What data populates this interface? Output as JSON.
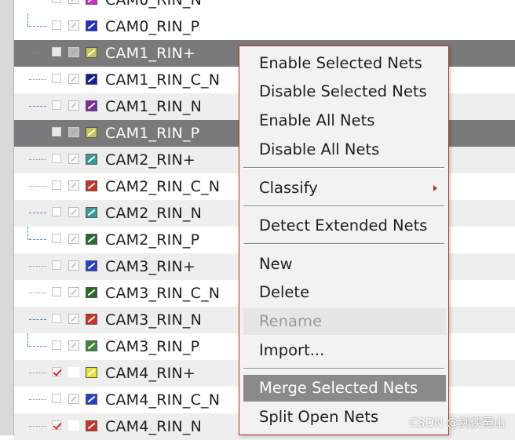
{
  "nets": [
    {
      "name": "CAM0_RIN_N",
      "color": "#d02cd0",
      "checked": false,
      "visible": true,
      "selected": false
    },
    {
      "name": "CAM0_RIN_P",
      "color": "#2030d0",
      "checked": false,
      "visible": true,
      "selected": false
    },
    {
      "name": "CAM1_RIN+",
      "color": "#c9c25a",
      "checked": false,
      "visible": true,
      "selected": true
    },
    {
      "name": "CAM1_RIN_C_N",
      "color": "#1020a0",
      "checked": false,
      "visible": true,
      "selected": false
    },
    {
      "name": "CAM1_RIN_N",
      "color": "#7a2aa0",
      "checked": false,
      "visible": true,
      "selected": false
    },
    {
      "name": "CAM1_RIN_P",
      "color": "#c9c25a",
      "checked": false,
      "visible": true,
      "selected": true
    },
    {
      "name": "CAM2_RIN+",
      "color": "#3a9a9a",
      "checked": false,
      "visible": true,
      "selected": false
    },
    {
      "name": "CAM2_RIN_C_N",
      "color": "#d03020",
      "checked": false,
      "visible": true,
      "selected": false
    },
    {
      "name": "CAM2_RIN_N",
      "color": "#3a9a9a",
      "checked": false,
      "visible": true,
      "selected": false
    },
    {
      "name": "CAM2_RIN_P",
      "color": "#2a6a2a",
      "checked": false,
      "visible": true,
      "selected": false
    },
    {
      "name": "CAM3_RIN+",
      "color": "#2040d0",
      "checked": false,
      "visible": true,
      "selected": false
    },
    {
      "name": "CAM3_RIN_C_N",
      "color": "#2a6a2a",
      "checked": false,
      "visible": true,
      "selected": false
    },
    {
      "name": "CAM3_RIN_N",
      "color": "#d03020",
      "checked": false,
      "visible": true,
      "selected": false
    },
    {
      "name": "CAM3_RIN_P",
      "color": "#3a8a3a",
      "checked": false,
      "visible": true,
      "selected": false
    },
    {
      "name": "CAM4_RIN+",
      "color": "#e8e830",
      "checked": true,
      "visible": false,
      "selected": false
    },
    {
      "name": "CAM4_RIN_C_N",
      "color": "#2040d0",
      "checked": false,
      "visible": true,
      "selected": false
    },
    {
      "name": "CAM4_RIN_N",
      "color": "#d03020",
      "checked": true,
      "visible": false,
      "selected": false
    }
  ],
  "context_menu": {
    "items": [
      {
        "label": "Enable Selected Nets",
        "state": "normal"
      },
      {
        "label": "Disable Selected Nets",
        "state": "normal"
      },
      {
        "label": "Enable All Nets",
        "state": "normal"
      },
      {
        "label": "Disable All Nets",
        "state": "normal"
      },
      {
        "label": "Classify",
        "state": "normal",
        "submenu": true
      },
      {
        "label": "Detect Extended Nets",
        "state": "normal"
      },
      {
        "label": "New",
        "state": "normal"
      },
      {
        "label": "Delete",
        "state": "normal"
      },
      {
        "label": "Rename",
        "state": "disabled"
      },
      {
        "label": "Import...",
        "state": "normal"
      },
      {
        "label": "Merge Selected Nets",
        "state": "highlighted"
      },
      {
        "label": "Split Open Nets",
        "state": "normal"
      }
    ]
  },
  "watermark": "CSDN @剑侠蜀山",
  "colors": {
    "selection_row": "#7a7a7a",
    "menu_border": "#c62828",
    "menu_highlight": "#8a8a8a",
    "checkmark": "#dd2222"
  }
}
